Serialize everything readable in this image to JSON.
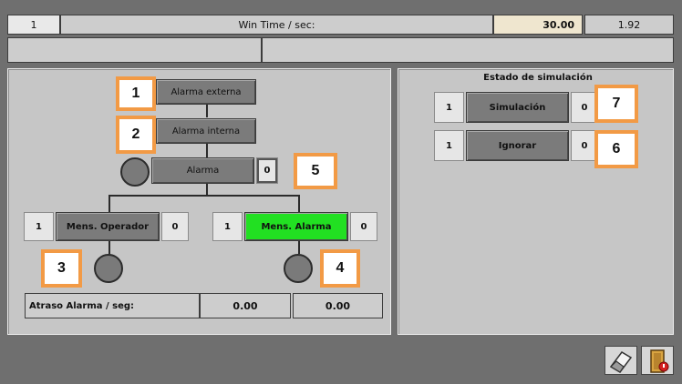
{
  "topbar": {
    "left_value": "1",
    "title": "Win Time / sec:",
    "time_value": "30.00",
    "right_value": "1.92"
  },
  "left_panel": {
    "alarm_externa": "Alarma externa",
    "alarm_interna": "Alarma interna",
    "alarma": "Alarma",
    "alarma_value": "0",
    "mens_operador_left": "1",
    "mens_operador": "Mens. Operador",
    "mens_operador_right": "0",
    "mens_alarma_left": "1",
    "mens_alarma": "Mens. Alarma",
    "mens_alarma_right": "0",
    "retraso_label": "Atraso Alarma / seg:",
    "retraso_value1": "0.00",
    "retraso_value2": "0.00"
  },
  "right_panel": {
    "title": "Estado de simulación",
    "sim_left": "1",
    "simulacion": "Simulación",
    "sim_right": "0",
    "ign_left": "1",
    "ignorar": "Ignorar",
    "ign_right": "0"
  },
  "badges": {
    "b1": "1",
    "b2": "2",
    "b3": "3",
    "b4": "4",
    "b5": "5",
    "b6": "6",
    "b7": "7"
  },
  "colors": {
    "frame": "#6f6f6f",
    "panel": "#c6c6c6",
    "active_green": "#22e022",
    "badge_border": "#f29a45",
    "time_field": "#efe6cf"
  },
  "icons": {
    "bottom_right_1": "eraser-icon",
    "bottom_right_2": "exit-door-icon"
  }
}
